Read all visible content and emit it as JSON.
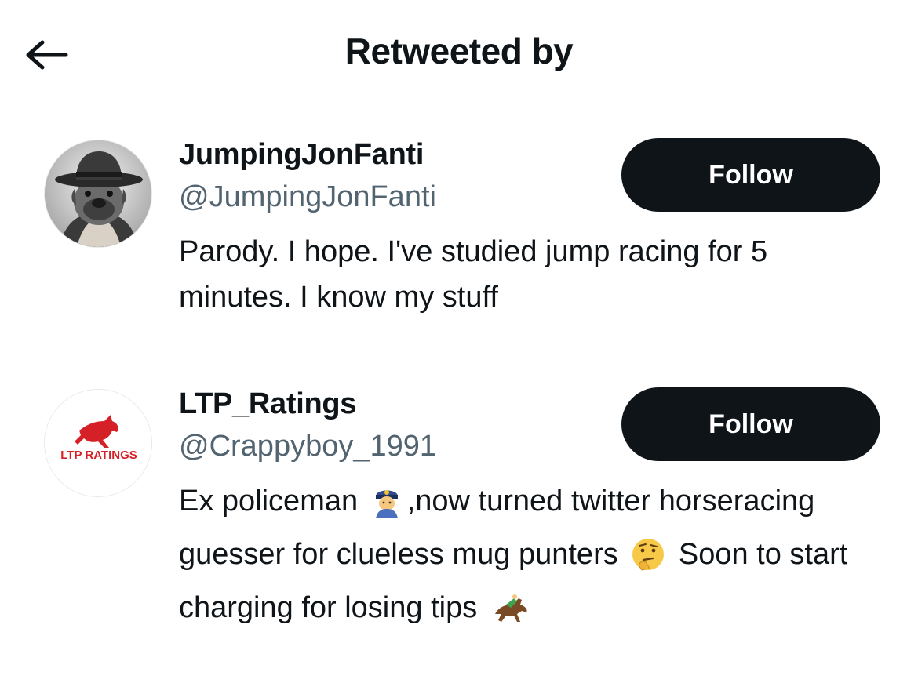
{
  "header": {
    "title": "Retweeted by",
    "back_icon": "arrow-left-icon"
  },
  "users": [
    {
      "display_name": "JumpingJonFanti",
      "handle": "@JumpingJonFanti",
      "bio": "Parody. I hope. I've studied jump racing for 5 minutes. I know my stuff",
      "follow_label": "Follow",
      "avatar": "bulldog-in-hat-avatar"
    },
    {
      "display_name": "LTP_Ratings",
      "handle": "@Crappyboy_1991",
      "bio_part1": "Ex policeman",
      "bio_emoji1": "police-officer-emoji",
      "bio_part2": ",now turned twitter horseracing guesser for clueless mug punters",
      "bio_emoji2": "thinking-face-emoji",
      "bio_part3": "Soon to start charging for losing tips",
      "bio_emoji3": "horse-racing-emoji",
      "follow_label": "Follow",
      "avatar": "ltp-ratings-logo-avatar",
      "avatar_logo_text": "LTP RATINGS"
    }
  ],
  "colors": {
    "button_bg": "#0f1419",
    "button_text": "#ffffff",
    "handle": "#536471",
    "logo_red": "#d62027"
  }
}
